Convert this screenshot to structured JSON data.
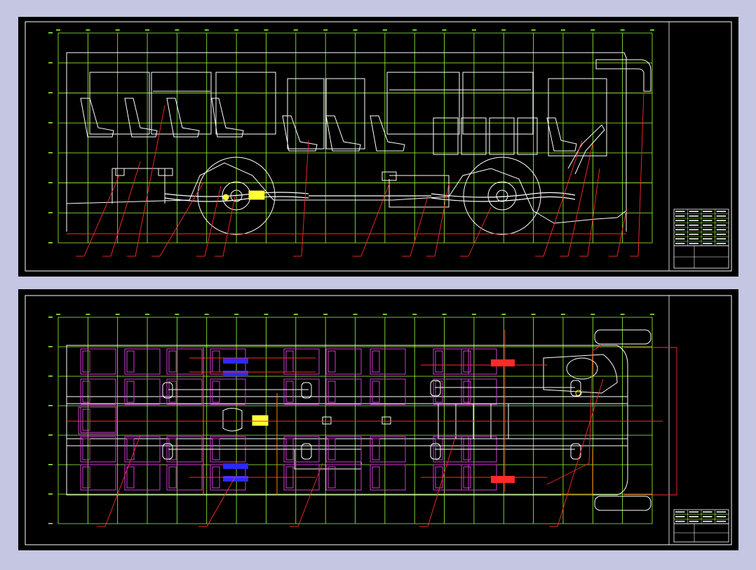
{
  "colors": {
    "backdrop": "#c4c6e2",
    "sheet": "#000000",
    "frame": "#ffffff",
    "grid": "#9cff3c",
    "outline": "#ffffff",
    "leader": "#ff2a2a",
    "seat": "#d23cd2",
    "axle": "#ffff33",
    "brake": "#2a2aff",
    "accent": "#ff8000"
  },
  "sheets": [
    {
      "name": "side-view",
      "title_block": {
        "rows": 8,
        "cols": 4
      }
    },
    {
      "name": "top-view",
      "title_block": {
        "rows": 3,
        "cols": 4
      }
    }
  ]
}
